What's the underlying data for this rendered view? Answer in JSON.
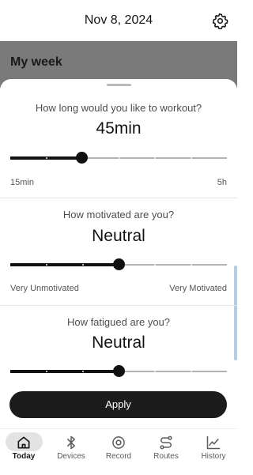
{
  "header": {
    "date": "Nov 8, 2024"
  },
  "background": {
    "section_title": "My week"
  },
  "sheet": {
    "workout": {
      "question": "How long would you like to workout?",
      "value": "45min",
      "range_min": "15min",
      "range_max": "5h",
      "level": 0.33
    },
    "motivation": {
      "question": "How motivated are you?",
      "value": "Neutral",
      "range_min": "Very Unmotivated",
      "range_max": "Very Motivated",
      "level": 0.5
    },
    "fatigue": {
      "question": "How fatigued are you?",
      "value": "Neutral",
      "level": 0.5
    },
    "apply_label": "Apply"
  },
  "nav": {
    "items": [
      {
        "label": "Today",
        "icon": "home-icon",
        "active": true
      },
      {
        "label": "Devices",
        "icon": "bluetooth-icon",
        "active": false
      },
      {
        "label": "Record",
        "icon": "record-icon",
        "active": false
      },
      {
        "label": "Routes",
        "icon": "routes-icon",
        "active": false
      },
      {
        "label": "History",
        "icon": "chart-icon",
        "active": false
      }
    ]
  },
  "colors": {
    "accent": "#1c1c1c",
    "track": "#b3b3b3",
    "scrim": "#7a7a7a"
  }
}
